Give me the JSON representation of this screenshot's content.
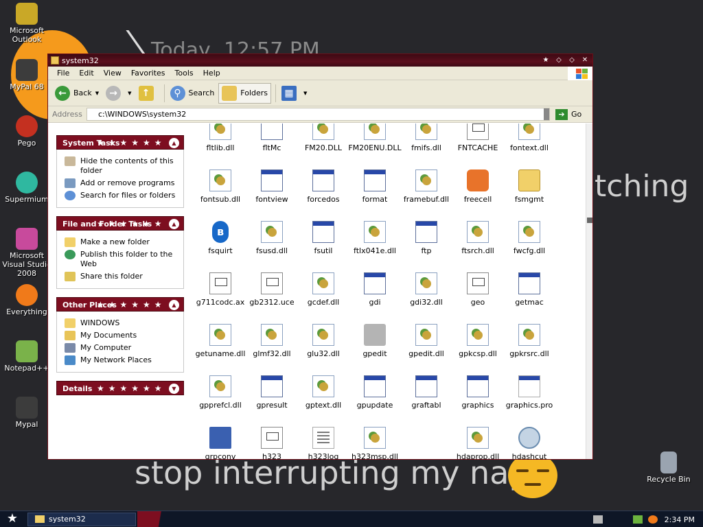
{
  "desktop": {
    "wallpaper_text": {
      "top": "Today, 12:57 PM",
      "right": "tching",
      "bottom": "stop interrupting my nap"
    },
    "icons": [
      {
        "label": "Microsoft Outlook",
        "icon": "outlook-icon",
        "color": "#c9a827"
      },
      {
        "label": "MyPal 68",
        "icon": "mypal-icon",
        "color": "#3c3c3c"
      },
      {
        "label": "Pego",
        "icon": "pego-icon",
        "color": "#c43020"
      },
      {
        "label": "Supermium",
        "icon": "supermium-icon",
        "color": "#2fb8a0"
      },
      {
        "label": "Microsoft Visual Studio 2008",
        "icon": "visual-studio-icon",
        "color": "#c84a9c"
      },
      {
        "label": "Everything",
        "icon": "everything-icon",
        "color": "#f07a1a"
      },
      {
        "label": "Notepad++",
        "icon": "notepad-plus-plus-icon",
        "color": "#7ab24a"
      },
      {
        "label": "Mypal",
        "icon": "mypal-icon",
        "color": "#3c3c3c"
      }
    ],
    "recycle_bin": "Recycle Bin"
  },
  "window": {
    "title": "system32",
    "menu": [
      "File",
      "Edit",
      "View",
      "Favorites",
      "Tools",
      "Help"
    ],
    "toolbar": {
      "back": "Back",
      "search": "Search",
      "folders": "Folders"
    },
    "address": {
      "label": "Address",
      "value": "c:\\WINDOWS\\system32",
      "go": "Go"
    }
  },
  "taskpane": {
    "system_tasks": {
      "title": "System Tasks",
      "items": [
        "Hide the contents of this folder",
        "Add or remove programs",
        "Search for files or folders"
      ]
    },
    "file_folder_tasks": {
      "title": "File and Folder Tasks",
      "items": [
        "Make a new folder",
        "Publish this folder to the Web",
        "Share this folder"
      ]
    },
    "other_places": {
      "title": "Other Places",
      "items": [
        "WINDOWS",
        "My Documents",
        "My Computer",
        "My Network Places"
      ]
    },
    "details": {
      "title": "Details"
    }
  },
  "files": [
    {
      "name": "fltlib.dll",
      "type": "dll"
    },
    {
      "name": "fltMc",
      "type": "exe"
    },
    {
      "name": "FM20.DLL",
      "type": "dll"
    },
    {
      "name": "FM20ENU.DLL",
      "type": "dll"
    },
    {
      "name": "fmifs.dll",
      "type": "dll"
    },
    {
      "name": "FNTCACHE",
      "type": "txt"
    },
    {
      "name": "fontext.dll",
      "type": "dll"
    },
    {
      "name": "fontsub.dll",
      "type": "dll"
    },
    {
      "name": "fontview",
      "type": "exe"
    },
    {
      "name": "forcedos",
      "type": "exe"
    },
    {
      "name": "format",
      "type": "exe"
    },
    {
      "name": "framebuf.dll",
      "type": "dll"
    },
    {
      "name": "freecell",
      "type": "cell"
    },
    {
      "name": "fsmgmt",
      "type": "folder"
    },
    {
      "name": "fsquirt",
      "type": "bt"
    },
    {
      "name": "fsusd.dll",
      "type": "dll"
    },
    {
      "name": "fsutil",
      "type": "exe"
    },
    {
      "name": "ftlx041e.dll",
      "type": "dll"
    },
    {
      "name": "ftp",
      "type": "exe"
    },
    {
      "name": "ftsrch.dll",
      "type": "dll"
    },
    {
      "name": "fwcfg.dll",
      "type": "dll"
    },
    {
      "name": "g711codc.ax",
      "type": "txt"
    },
    {
      "name": "gb2312.uce",
      "type": "txt"
    },
    {
      "name": "gcdef.dll",
      "type": "dll"
    },
    {
      "name": "gdi",
      "type": "exe"
    },
    {
      "name": "gdi32.dll",
      "type": "dll"
    },
    {
      "name": "geo",
      "type": "txt"
    },
    {
      "name": "getmac",
      "type": "exe"
    },
    {
      "name": "getuname.dll",
      "type": "dll"
    },
    {
      "name": "glmf32.dll",
      "type": "dll"
    },
    {
      "name": "glu32.dll",
      "type": "dll"
    },
    {
      "name": "gpedit",
      "type": "tool"
    },
    {
      "name": "gpedit.dll",
      "type": "dll"
    },
    {
      "name": "gpkcsp.dll",
      "type": "dll"
    },
    {
      "name": "gpkrsrc.dll",
      "type": "dll"
    },
    {
      "name": "gpprefcl.dll",
      "type": "dll"
    },
    {
      "name": "gpresult",
      "type": "exe"
    },
    {
      "name": "gptext.dll",
      "type": "dll"
    },
    {
      "name": "gpupdate",
      "type": "exe"
    },
    {
      "name": "graftabl",
      "type": "exe"
    },
    {
      "name": "graphics",
      "type": "exe"
    },
    {
      "name": "graphics.pro",
      "type": "shortcut"
    },
    {
      "name": "grpconv",
      "type": "conv"
    },
    {
      "name": "h323",
      "type": "txt"
    },
    {
      "name": "h323log",
      "type": "log"
    },
    {
      "name": "h323msp.dll",
      "type": "dll"
    },
    {
      "name": "",
      "type": "blank"
    },
    {
      "name": "hdaprop.dll",
      "type": "dll"
    },
    {
      "name": "hdashcut",
      "type": "sound"
    }
  ],
  "taskbar": {
    "task": "system32",
    "clock": "2:34 PM"
  },
  "colors": {
    "titlebar": "#5b0f1c",
    "panel_header": "#7d0e20",
    "taskbar": "#0e1626"
  }
}
